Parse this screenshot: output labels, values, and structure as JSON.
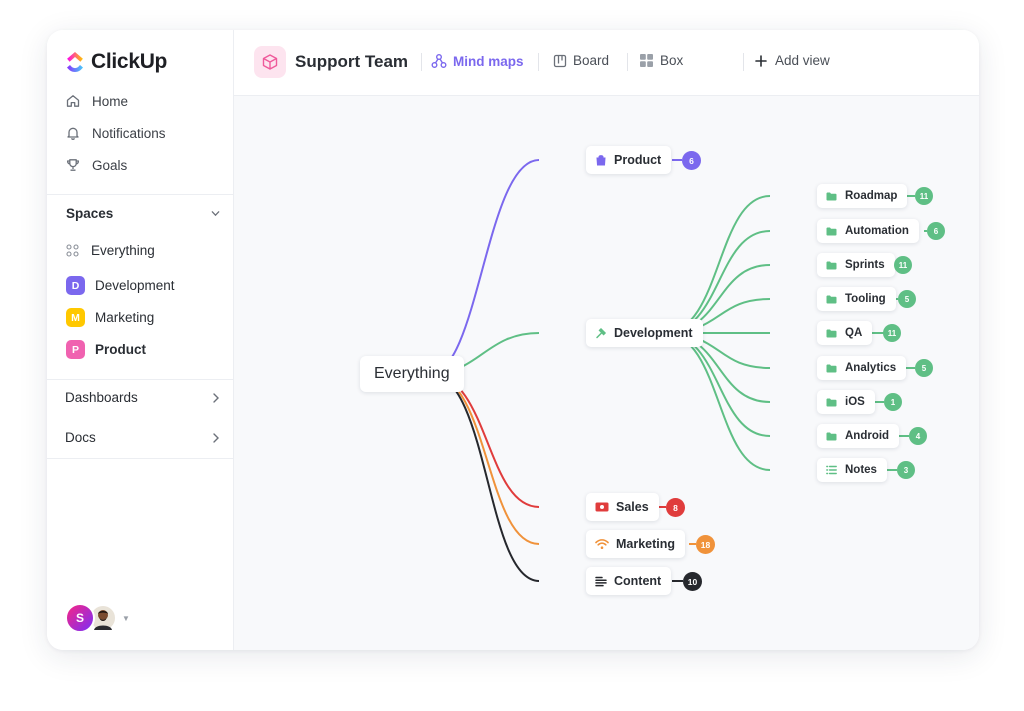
{
  "brand": {
    "name": "ClickUp"
  },
  "sidebar": {
    "nav": [
      {
        "label": "Home",
        "icon": "home-icon"
      },
      {
        "label": "Notifications",
        "icon": "bell-icon"
      },
      {
        "label": "Goals",
        "icon": "trophy-icon"
      }
    ],
    "spaces_heading": "Spaces",
    "spaces": [
      {
        "label": "Everything",
        "badge": "",
        "color": ""
      },
      {
        "label": "Development",
        "badge": "D",
        "color": "#7b68ee"
      },
      {
        "label": "Marketing",
        "badge": "M",
        "color": "#ffc800"
      },
      {
        "label": "Product",
        "badge": "P",
        "color": "#f062b0"
      }
    ],
    "links": [
      {
        "label": "Dashboards"
      },
      {
        "label": "Docs"
      }
    ],
    "avatar_initial": "S"
  },
  "topbar": {
    "title": "Support Team",
    "tabs": [
      {
        "label": "Mind maps",
        "active": true
      },
      {
        "label": "Board",
        "active": false
      },
      {
        "label": "Box",
        "active": false
      },
      {
        "label": "Add view",
        "active": false
      }
    ]
  },
  "mindmap": {
    "root": "Everything",
    "branches": [
      {
        "label": "Product",
        "count": "6",
        "color": "#7b68ee",
        "icon": "bag-icon"
      },
      {
        "label": "Development",
        "count": "",
        "color": "#5fbf85",
        "icon": "hammer-icon"
      },
      {
        "label": "Sales",
        "count": "8",
        "color": "#e03c3c",
        "icon": "cash-icon"
      },
      {
        "label": "Marketing",
        "count": "18",
        "color": "#f0923a",
        "icon": "wifi-icon"
      },
      {
        "label": "Content",
        "count": "10",
        "color": "#26282d",
        "icon": "text-lines-icon"
      }
    ],
    "dev_children": [
      {
        "label": "Roadmap",
        "count": "11"
      },
      {
        "label": "Automation",
        "count": "6"
      },
      {
        "label": "Sprints",
        "count": "11"
      },
      {
        "label": "Tooling",
        "count": "5"
      },
      {
        "label": "QA",
        "count": "11"
      },
      {
        "label": "Analytics",
        "count": "5"
      },
      {
        "label": "iOS",
        "count": "1"
      },
      {
        "label": "Android",
        "count": "4"
      },
      {
        "label": "Notes",
        "count": "3"
      }
    ]
  }
}
